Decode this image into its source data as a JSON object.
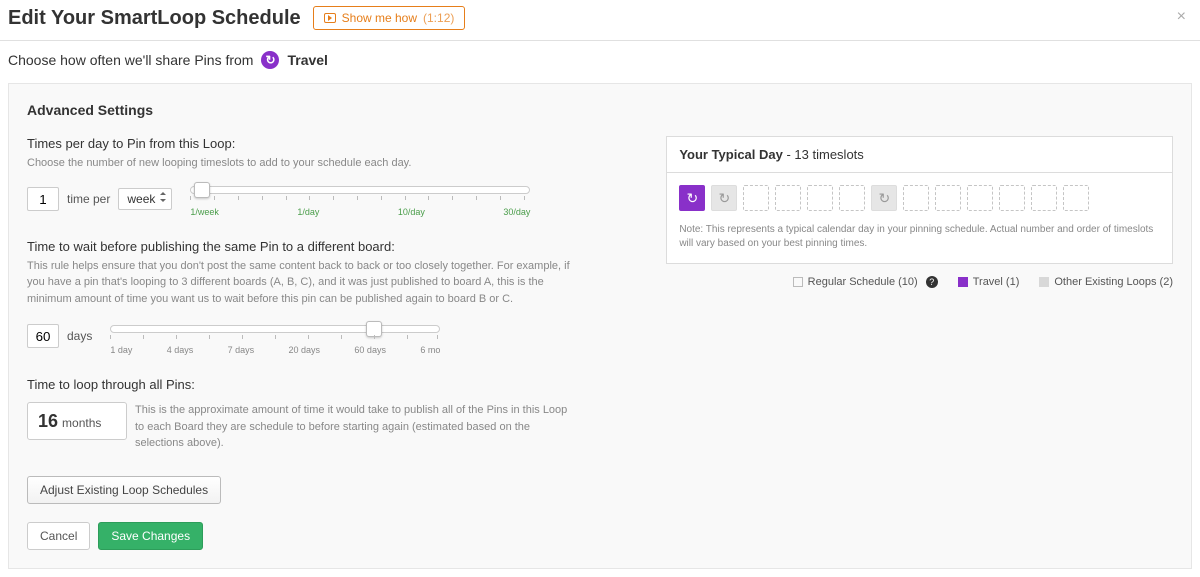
{
  "header": {
    "title": "Edit Your SmartLoop Schedule",
    "show_how": "Show me how",
    "show_how_time": "(1:12)"
  },
  "sub": {
    "prefix": "Choose how often we'll share Pins from",
    "loop_name": "Travel"
  },
  "panel": {
    "title": "Advanced Settings"
  },
  "times": {
    "title": "Times per day to Pin from this Loop:",
    "help": "Choose the number of new looping timeslots to add to your schedule each day.",
    "value": "1",
    "per_label": "time per",
    "per_unit": "week",
    "scale": {
      "min": "1/week",
      "mid1": "1/day",
      "mid2": "10/day",
      "max": "30/day"
    }
  },
  "wait": {
    "title": "Time to wait before publishing the same Pin to a different board:",
    "help": "This rule helps ensure that you don't post the same content back to back or too closely together. For example, if you have a pin that's looping to 3 different boards (A, B, C), and it was just published to board A, this is the minimum amount of time you want us to wait before this pin can be published again to board B or C.",
    "value": "60",
    "unit": "days",
    "scale": {
      "a": "1 day",
      "b": "4 days",
      "c": "7 days",
      "d": "20 days",
      "e": "60 days",
      "f": "6 mo"
    }
  },
  "loop_time": {
    "title": "Time to loop through all Pins:",
    "value": "16",
    "unit": "months",
    "help": "This is the approximate amount of time it would take to publish all of the Pins in this Loop to each Board they are schedule to before starting again (estimated based on the selections above)."
  },
  "typical": {
    "title_b": "Your Typical Day",
    "title_rest": " - 13 timeslots",
    "note": "Note: This represents a typical calendar day in your pinning schedule. Actual number and order of timeslots will vary based on your best pinning times.",
    "legend": {
      "regular": "Regular Schedule (10)",
      "travel": "Travel (1)",
      "other": "Other Existing Loops (2)"
    }
  },
  "buttons": {
    "adjust": "Adjust Existing Loop Schedules",
    "cancel": "Cancel",
    "save": "Save Changes"
  }
}
